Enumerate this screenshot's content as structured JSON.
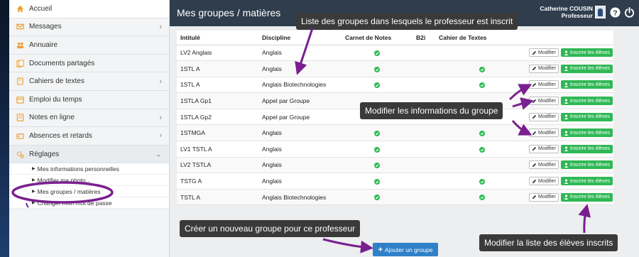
{
  "sidebar": {
    "items": [
      {
        "label": "Accueil",
        "icon": "home-icon",
        "chevron": false
      },
      {
        "label": "Messages",
        "icon": "envelope-icon",
        "chevron": true
      },
      {
        "label": "Annuaire",
        "icon": "people-icon",
        "chevron": false
      },
      {
        "label": "Documents partagés",
        "icon": "documents-icon",
        "chevron": false
      },
      {
        "label": "Cahiers de textes",
        "icon": "book-icon",
        "chevron": true
      },
      {
        "label": "Emploi du temps",
        "icon": "calendar-icon",
        "chevron": false
      },
      {
        "label": "Notes en ligne",
        "icon": "notes-icon",
        "chevron": true
      },
      {
        "label": "Absences et retards",
        "icon": "absences-icon",
        "chevron": true
      },
      {
        "label": "Réglages",
        "icon": "gears-icon",
        "chevron": true
      }
    ],
    "sub_items": [
      "Mes informations personnelles",
      "Modifier ma photo...",
      "Mes groupes / matières",
      "Changer mon mot de passe"
    ]
  },
  "header": {
    "title": "Mes groupes / matières",
    "user_name": "Catherine COUSIN",
    "user_role": "Professeur",
    "help_glyph": "?"
  },
  "table": {
    "columns": [
      "Intitulé",
      "Discipline",
      "Carnet de Notes",
      "B2i",
      "Cahier de Textes",
      ""
    ],
    "rows": [
      {
        "name": "LV2 Anglais",
        "discipline": "Anglais",
        "notes": true,
        "b2i": false,
        "cahier": false
      },
      {
        "name": "1STL A",
        "discipline": "Anglais",
        "notes": true,
        "b2i": false,
        "cahier": true
      },
      {
        "name": "1STL A",
        "discipline": "Anglais Biotechnologies",
        "notes": true,
        "b2i": false,
        "cahier": true
      },
      {
        "name": "1STLA Gp1",
        "discipline": "Appel par Groupe",
        "notes": false,
        "b2i": false,
        "cahier": false
      },
      {
        "name": "1STLA Gp2",
        "discipline": "Appel par Groupe",
        "notes": false,
        "b2i": false,
        "cahier": false
      },
      {
        "name": "1STMGA",
        "discipline": "Anglais",
        "notes": true,
        "b2i": false,
        "cahier": true
      },
      {
        "name": "LV1 TSTL A",
        "discipline": "Anglais",
        "notes": true,
        "b2i": false,
        "cahier": true
      },
      {
        "name": "LV2 TSTLA",
        "discipline": "Anglais",
        "notes": true,
        "b2i": false,
        "cahier": false
      },
      {
        "name": "TSTG A",
        "discipline": "Anglais",
        "notes": true,
        "b2i": false,
        "cahier": true
      },
      {
        "name": "TSTL A",
        "discipline": "Anglais Biotechnologies",
        "notes": true,
        "b2i": false,
        "cahier": true
      }
    ],
    "modify_label": "Modifier",
    "enroll_label": "Inscrire les élèves"
  },
  "add_button_label": "Ajouter un groupe",
  "callouts": {
    "top": "Liste des groupes dans lesquels le professeur est inscrit",
    "middle": "Modifier les informations du groupe",
    "bottom_left": "Créer un nouveau groupe pour ce professeur",
    "bottom_right": "Modifier la liste des élèves inscrits"
  },
  "colors": {
    "header_bg": "#2f3d4d",
    "accent_orange": "#f0a030",
    "check_green": "#2fb855",
    "add_blue": "#2f80c9",
    "annotation_purple": "#7a1f8f"
  }
}
